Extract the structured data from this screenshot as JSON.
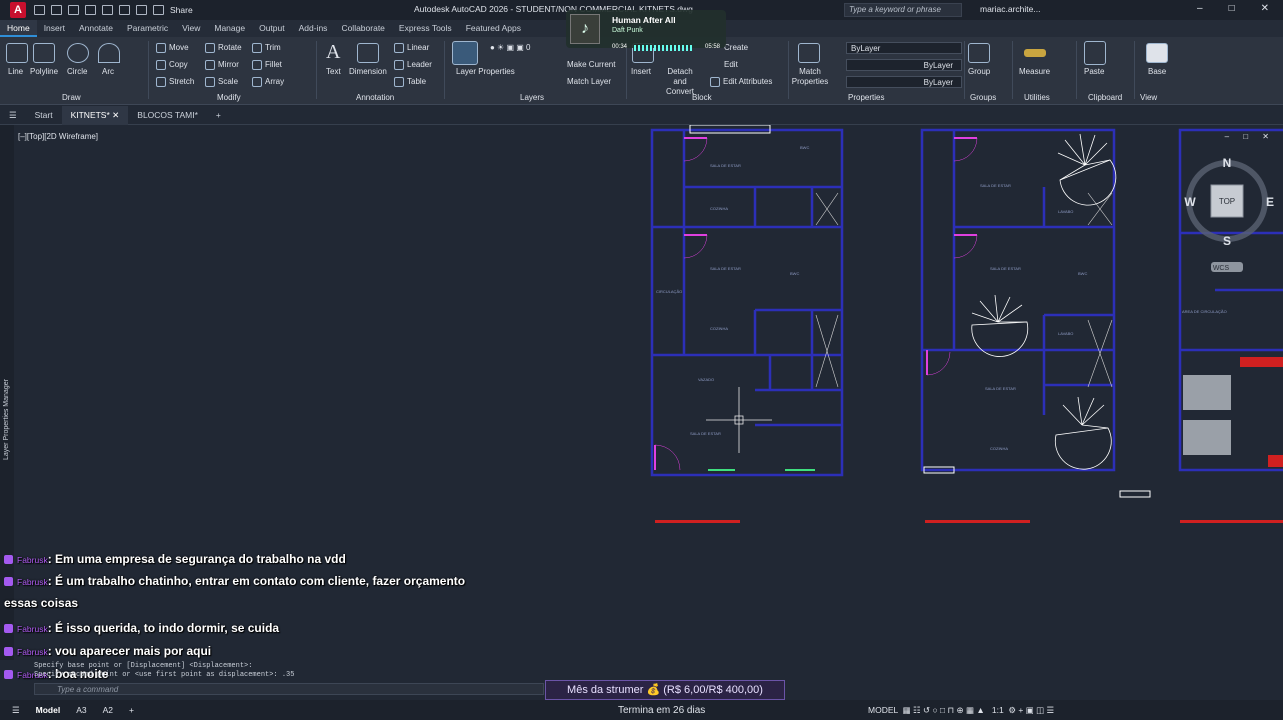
{
  "app": {
    "title": "Autodesk AutoCAD 2026 - STUDENT/NON COMMERCIAL   KITNETS.dwg",
    "share_label": "Share",
    "search_placeholder": "Type a keyword or phrase",
    "user": "mariac.archite...",
    "logo": "A"
  },
  "ribbon_tabs": [
    "Home",
    "Insert",
    "Annotate",
    "Parametric",
    "View",
    "Manage",
    "Output",
    "Add-ins",
    "Collaborate",
    "Express Tools",
    "Featured Apps"
  ],
  "ribbon": {
    "draw": {
      "group": "Draw",
      "line": "Line",
      "polyline": "Polyline",
      "circle": "Circle",
      "arc": "Arc"
    },
    "modify": {
      "group": "Modify",
      "move": "Move",
      "rotate": "Rotate",
      "trim": "Trim",
      "copy": "Copy",
      "mirror": "Mirror",
      "fillet": "Fillet",
      "stretch": "Stretch",
      "scale": "Scale",
      "array": "Array"
    },
    "annotation": {
      "group": "Annotation",
      "text": "Text",
      "dimension": "Dimension",
      "linear": "Linear",
      "leader": "Leader",
      "table": "Table"
    },
    "layers": {
      "group": "Layers",
      "layer_properties": "Layer Properties",
      "make_current": "Make Current",
      "match_layer": "Match Layer",
      "layer_value": "0"
    },
    "block": {
      "group": "Block",
      "insert": "Insert",
      "detach_convert": "Detach and Convert",
      "create": "Create",
      "edit": "Edit",
      "edit_attributes": "Edit Attributes"
    },
    "properties": {
      "group": "Properties",
      "match_properties": "Match Properties",
      "bylayer_1": "ByLayer",
      "bylayer_2": "ByLayer",
      "bylayer_3": "ByLayer"
    },
    "groups": {
      "group": "Groups",
      "group_btn": "Group"
    },
    "utilities": {
      "group": "Utilities",
      "measure": "Measure"
    },
    "clipboard": {
      "group": "Clipboard",
      "paste": "Paste"
    },
    "view": {
      "group": "View",
      "base": "Base"
    }
  },
  "now_playing": {
    "title": "Human After All",
    "artist": "Daft Punk",
    "elapsed": "00:34",
    "total": "05:58"
  },
  "doc_tabs": [
    "Start",
    "KITNETS*",
    "BLOCOS TAMI*"
  ],
  "viewport": {
    "label": "[–][Top][2D Wireframe]",
    "controls": "– □ ✕"
  },
  "viewcube": {
    "n": "N",
    "s": "S",
    "e": "E",
    "w": "W",
    "top": "TOP",
    "wcs": "WCS"
  },
  "side_panel_label": "Layer Properties Manager",
  "chat": [
    {
      "user": "Fabrusk",
      "text": ": Em uma empresa de segurança do trabalho na vdd"
    },
    {
      "user": "Fabrusk",
      "text": ": É um trabalho chatinho, entrar em contato com cliente, fazer orçamento essas coisas"
    },
    {
      "user": "Fabrusk",
      "text": ": É isso querida, to indo dormir, se cuida"
    },
    {
      "user": "Fabrusk",
      "text": ": vou aparecer mais por aqui"
    },
    {
      "user": "Fabrusk",
      "text": ": boa noite"
    }
  ],
  "command": {
    "history_1": "Specify base point or [Displacement] <Displacement>:",
    "history_2": "Specify second point or <use first point as displacement>: .35",
    "placeholder": "Type a command"
  },
  "overlay": {
    "goal": "Mês da strumer 💰 (R$ 6,00/R$ 400,00)",
    "termina": "Termina em 26 dias"
  },
  "status": {
    "model_tab": "Model",
    "layout1": "A3",
    "layout2": "A2",
    "model_space": "MODEL",
    "scale": "1:1"
  }
}
